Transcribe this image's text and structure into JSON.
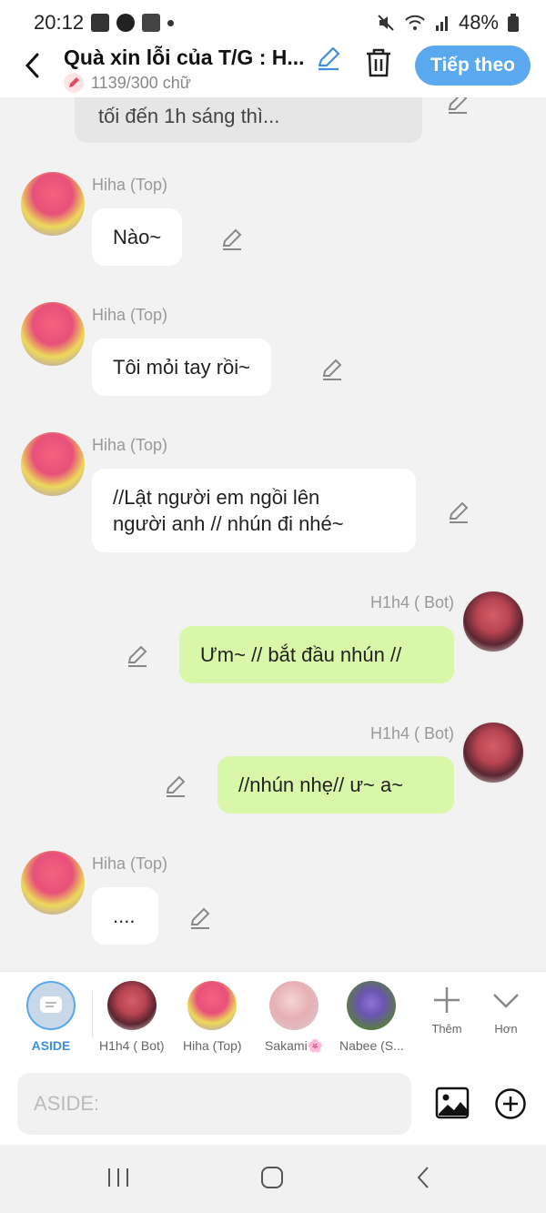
{
  "status_bar": {
    "time": "20:12",
    "battery": "48%"
  },
  "header": {
    "title": "Quà xin lỗi của T/G : H...",
    "word_count": "1139/300 chữ",
    "next_button": "Tiếp theo"
  },
  "chat": {
    "previous_message": "tối đến 1h sáng thì...",
    "messages": [
      {
        "sender": "Hiha (Top)",
        "text": "Nào~"
      },
      {
        "sender": "Hiha (Top)",
        "text": "Tôi mỏi tay rồi~"
      },
      {
        "sender": "Hiha (Top)",
        "text_line1": "//Lật người em ngồi lên",
        "text_line2": "người anh // nhún đi nhé~"
      },
      {
        "sender": "H1h4 ( Bot)",
        "text": "Ưm~ // bắt đầu nhún //"
      },
      {
        "sender": "H1h4 ( Bot)",
        "text": "//nhún nhẹ// ư~ a~"
      },
      {
        "sender": "Hiha (Top)",
        "text": "...."
      }
    ]
  },
  "characters": [
    {
      "label": "ASIDE"
    },
    {
      "label": "H1h4 ( Bot)"
    },
    {
      "label": "Hiha (Top)"
    },
    {
      "label": "Sakami🌸"
    },
    {
      "label": "Nabee (S..."
    }
  ],
  "tools": {
    "more_label": "Thêm",
    "less_label": "Hơn"
  },
  "input": {
    "placeholder": "ASIDE:"
  },
  "colors": {
    "accent": "#5aa8ee",
    "bot_bubble": "#d9f7a8",
    "user_bubble": "#ffffff"
  }
}
